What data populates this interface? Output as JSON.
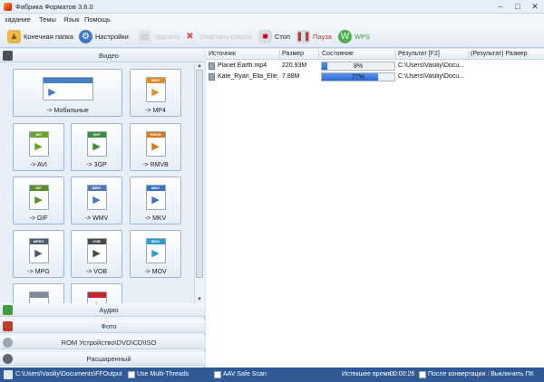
{
  "window": {
    "title": "Фабрика Форматов 3.6.0"
  },
  "menu": [
    "задание",
    "Темы",
    "Язык",
    "Помощь"
  ],
  "toolbar": {
    "output_folder": "Конечная папка",
    "settings": "Настройки",
    "remove": "Удалить",
    "clear_list": "Очистить список",
    "stop": "Стоп",
    "pause": "Пауза",
    "wps": "WPS"
  },
  "categories": {
    "video": "Видео",
    "audio": "Аудио",
    "photo": "Фото",
    "rom": "ROM Устройство\\DVD\\CD\\ISO",
    "advanced": "Расширенный"
  },
  "video_tiles": [
    {
      "label": "-> Мобильные",
      "badge": "",
      "color": "#4a7fc1"
    },
    {
      "label": "-> MP4",
      "badge": "MP4",
      "color": "#e0902a"
    },
    {
      "label": "-> AVI",
      "badge": "AVI",
      "color": "#6aa52b"
    },
    {
      "label": "-> 3GP",
      "badge": "3GP",
      "color": "#3c8c3c"
    },
    {
      "label": "-> RMVB",
      "badge": "RMVB",
      "color": "#d57a1f"
    },
    {
      "label": "-> GIF",
      "badge": "GIF",
      "color": "#5b8f2d"
    },
    {
      "label": "-> WMV",
      "badge": "WMV",
      "color": "#5277b8"
    },
    {
      "label": "-> MKV",
      "badge": "MKV",
      "color": "#3a74c4"
    },
    {
      "label": "-> MPG",
      "badge": "MPEG",
      "color": "#4b5b6e"
    },
    {
      "label": "-> VOB",
      "badge": "VOB",
      "color": "#4a4a4a"
    },
    {
      "label": "-> MOV",
      "badge": "MOV",
      "color": "#2f9bd3"
    },
    {
      "label": "",
      "badge": "",
      "color": "#7c8a99"
    },
    {
      "label": "",
      "badge": "",
      "color": "#c8242a"
    }
  ],
  "table": {
    "headers": [
      "Источник",
      "Размер",
      "Состояние",
      "Результат [F2]",
      "(Результат) Размер"
    ],
    "rows": [
      {
        "source": "Planet Earth.mp4",
        "size": "220.93M",
        "progress": 8,
        "progress_text": "8%",
        "result": "C:\\Users\\Vasiliy\\Docu..."
      },
      {
        "source": "Kate_Ryan_Ella_Elle_...",
        "size": "7.88M",
        "progress": 77,
        "progress_text": "77%",
        "result": "C:\\Users\\Vasiliy\\Docu..."
      }
    ]
  },
  "statusbar": {
    "path": "C:\\Users\\Vasiliy\\Documents\\FFOutput",
    "multithreads": "Use Multi-Threads",
    "safe_scan": "AAV Safe Scan",
    "elapsed_label": "Истекшее время :",
    "elapsed_value": "00:00:26",
    "after_convert": "После конвертации : Выключить ПК"
  },
  "colors": {
    "progress": "#2e6ad6",
    "status_bar": "#2f5a96",
    "stop": "#d0021b"
  }
}
